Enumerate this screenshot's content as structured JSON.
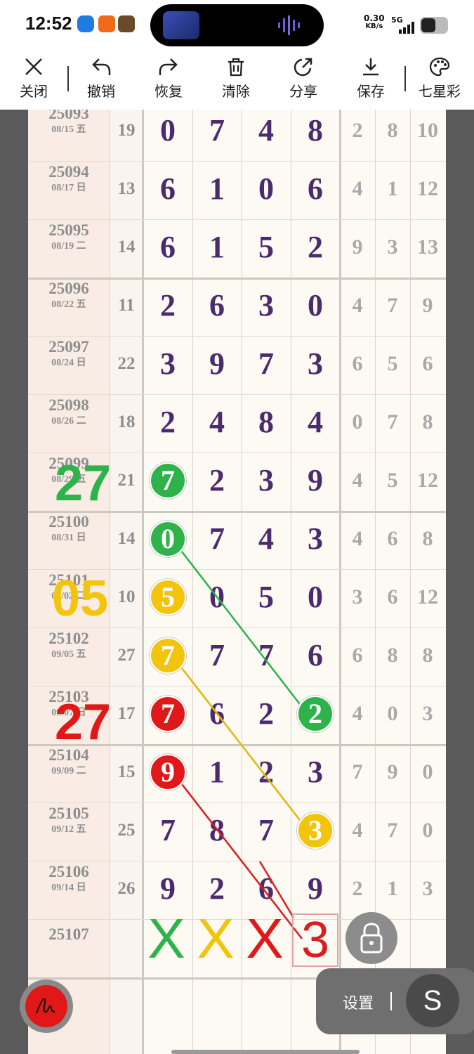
{
  "status": {
    "time": "12:52",
    "net_speed": "0.30",
    "net_unit": "KB/s",
    "network": "5G"
  },
  "toolbar": {
    "close": "关闭",
    "undo": "撤销",
    "redo": "恢复",
    "clear": "清除",
    "share": "分享",
    "save": "保存",
    "lottery": "七星彩"
  },
  "rows": [
    {
      "period": "25093",
      "date": "08/15 五",
      "sum": "19",
      "digits": [
        "0",
        "7",
        "4",
        "8"
      ],
      "extra": [
        "2",
        "8",
        "10"
      ]
    },
    {
      "period": "25094",
      "date": "08/17 日",
      "sum": "13",
      "digits": [
        "6",
        "1",
        "0",
        "6"
      ],
      "extra": [
        "4",
        "1",
        "12"
      ]
    },
    {
      "period": "25095",
      "date": "08/19 二",
      "sum": "14",
      "digits": [
        "6",
        "1",
        "5",
        "2"
      ],
      "extra": [
        "9",
        "3",
        "13"
      ]
    },
    {
      "period": "25096",
      "date": "08/22 五",
      "sum": "11",
      "digits": [
        "2",
        "6",
        "3",
        "0"
      ],
      "extra": [
        "4",
        "7",
        "9"
      ]
    },
    {
      "period": "25097",
      "date": "08/24 日",
      "sum": "22",
      "digits": [
        "3",
        "9",
        "7",
        "3"
      ],
      "extra": [
        "6",
        "5",
        "6"
      ]
    },
    {
      "period": "25098",
      "date": "08/26 二",
      "sum": "18",
      "digits": [
        "2",
        "4",
        "8",
        "4"
      ],
      "extra": [
        "0",
        "7",
        "8"
      ]
    },
    {
      "period": "25099",
      "date": "08/29 五",
      "sum": "21",
      "digits": [
        "7",
        "2",
        "3",
        "9"
      ],
      "extra": [
        "4",
        "5",
        "12"
      ]
    },
    {
      "period": "25100",
      "date": "08/31 日",
      "sum": "14",
      "digits": [
        "0",
        "7",
        "4",
        "3"
      ],
      "extra": [
        "4",
        "6",
        "8"
      ]
    },
    {
      "period": "25101",
      "date": "09/02 二",
      "sum": "10",
      "digits": [
        "5",
        "0",
        "5",
        "0"
      ],
      "extra": [
        "3",
        "6",
        "12"
      ]
    },
    {
      "period": "25102",
      "date": "09/05 五",
      "sum": "27",
      "digits": [
        "7",
        "7",
        "7",
        "6"
      ],
      "extra": [
        "6",
        "8",
        "8"
      ]
    },
    {
      "period": "25103",
      "date": "09/07 日",
      "sum": "17",
      "digits": [
        "7",
        "6",
        "2",
        "2"
      ],
      "extra": [
        "4",
        "0",
        "3"
      ]
    },
    {
      "period": "25104",
      "date": "09/09 二",
      "sum": "15",
      "digits": [
        "9",
        "1",
        "2",
        "3"
      ],
      "extra": [
        "7",
        "9",
        "0"
      ]
    },
    {
      "period": "25105",
      "date": "09/12 五",
      "sum": "25",
      "digits": [
        "7",
        "8",
        "7",
        "3"
      ],
      "extra": [
        "4",
        "7",
        "0"
      ]
    },
    {
      "period": "25106",
      "date": "09/14 日",
      "sum": "26",
      "digits": [
        "9",
        "2",
        "6",
        "9"
      ],
      "extra": [
        "2",
        "1",
        "3"
      ]
    }
  ],
  "next": {
    "period": "25107",
    "marks": [
      "X",
      "X",
      "X"
    ],
    "prediction": "3"
  },
  "annotations": {
    "green_note": "27",
    "yellow_note": "05",
    "red_note": "27"
  },
  "settings": {
    "label": "设置",
    "button": "S"
  },
  "colors": {
    "green": "#2db34a",
    "yellow": "#f2c40c",
    "red": "#e01818",
    "digit": "#4b2a6e"
  }
}
